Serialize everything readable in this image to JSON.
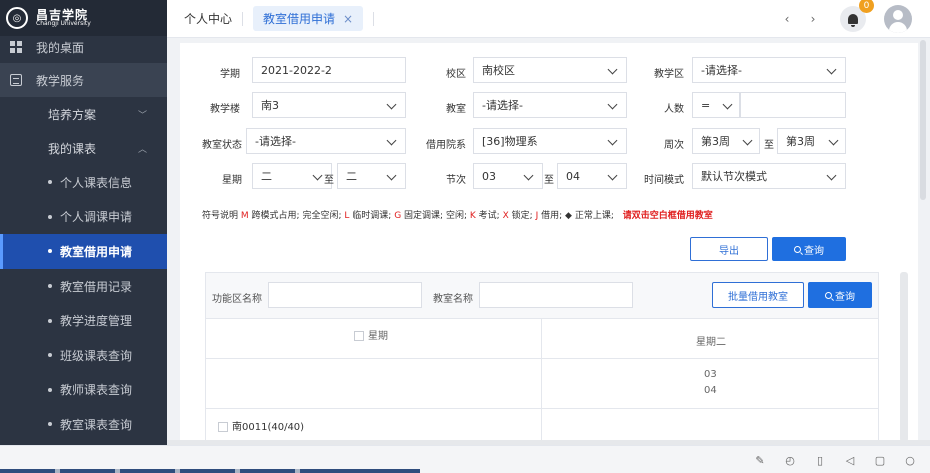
{
  "sidebar": {
    "logo": {
      "zh": "昌吉学院",
      "en": "Changji University"
    },
    "top_item": "我的桌面",
    "group": "教学服务",
    "sub_items": [
      {
        "label": "培养方案",
        "chevron": "﹀"
      },
      {
        "label": "我的课表",
        "chevron": "︿"
      }
    ],
    "items": [
      {
        "label": "个人课表信息"
      },
      {
        "label": "个人调课申请"
      },
      {
        "label": "教室借用申请"
      },
      {
        "label": "教室借用记录"
      },
      {
        "label": "教学进度管理"
      },
      {
        "label": "班级课表查询"
      },
      {
        "label": "教师课表查询"
      },
      {
        "label": "教室课表查询"
      }
    ],
    "active_index": 2
  },
  "header": {
    "tab_home": "个人中心",
    "tab_active": "教室借用申请",
    "tab_close": "×",
    "nav_prev": "‹",
    "nav_next": "›",
    "badge": "0"
  },
  "form": {
    "xueqi": {
      "label": "学期",
      "value": "2021-2022-2"
    },
    "xiaoqu": {
      "label": "校区",
      "value": "南校区"
    },
    "jiaoxuequ": {
      "label": "教学区",
      "value": "-请选择-"
    },
    "jiaoxuelou": {
      "label": "教学楼",
      "value": "南3"
    },
    "jiaoshi": {
      "label": "教室",
      "value": "-请选择-"
    },
    "renshu": {
      "label": "人数",
      "op": "=",
      "value": ""
    },
    "zhuangtai": {
      "label": "教室状态",
      "value": "-请选择-"
    },
    "yuanxi": {
      "label": "借用院系",
      "value": "[36]物理系"
    },
    "zhouci": {
      "label": "周次",
      "from": "第3周",
      "to": "第3周"
    },
    "xingqi": {
      "label": "星期",
      "from": "二",
      "to": "二"
    },
    "jieci": {
      "label": "节次",
      "from": "03",
      "to": "04"
    },
    "shijian": {
      "label": "时间模式",
      "value": "默认节次模式"
    },
    "zhi": "至"
  },
  "legend": {
    "prefix": "符号说明",
    "items": [
      {
        "sym": "M",
        "text": "跨模式占用;"
      },
      {
        "sym": "",
        "text": "完全空闲;"
      },
      {
        "sym": "L",
        "text": "临时调课;"
      },
      {
        "sym": "G",
        "text": "固定调课;"
      },
      {
        "sym": "",
        "text": "空闲;"
      },
      {
        "sym": "K",
        "text": "考试;"
      },
      {
        "sym": "X",
        "text": "锁定;"
      },
      {
        "sym": "J",
        "text": "借用;"
      },
      {
        "sym": "◆",
        "text": "正常上课;"
      }
    ],
    "hint": "请双击空白框借用教室"
  },
  "buttons": {
    "export": "导出",
    "query": "查询",
    "batch": "批量借用教室",
    "query2": "查询"
  },
  "panel": {
    "func_label": "功能区名称",
    "room_label": "教室名称",
    "col1_header": "星期",
    "col2_header": "星期二",
    "periods": [
      "03",
      "04"
    ],
    "first_room": "南0011(40/40)"
  },
  "colors": {
    "accent": "#1f6fe0",
    "sidebar": "#2c3442",
    "active": "#1f4fae",
    "red": "#e02020"
  }
}
